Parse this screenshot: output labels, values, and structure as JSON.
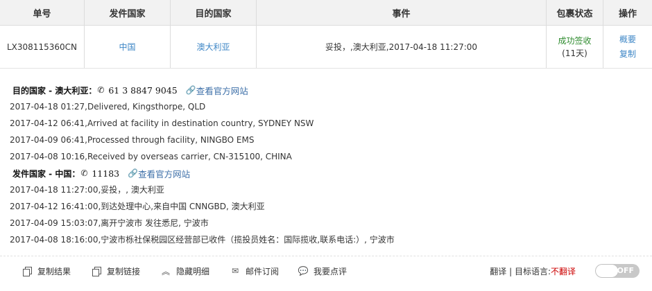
{
  "table": {
    "headers": [
      "单号",
      "发件国家",
      "目的国家",
      "事件",
      "包裹状态",
      "操作"
    ],
    "row": {
      "tracking_no": "LX308115360CN",
      "origin": "中国",
      "destination": "澳大利亚",
      "event": "妥投，,澳大利亚,2017-04-18 11:27:00",
      "status": "成功签收",
      "days": "(11天)",
      "op_summary": "概要",
      "op_copy": "复制"
    }
  },
  "destination_section": {
    "title": "目的国家 - 澳大利亚：",
    "phone": "61 3 8847 9045",
    "site_link": "查看官方网站",
    "events": [
      "2017-04-18 01:27,Delivered, Kingsthorpe, QLD",
      "2017-04-12 06:41,Arrived at facility in destination country, SYDNEY NSW",
      "2017-04-09 06:41,Processed through facility, NINGBO EMS",
      "2017-04-08 10:16,Received by overseas carrier, CN-315100, CHINA"
    ]
  },
  "origin_section": {
    "title": "发件国家 - 中国：",
    "phone": "11183",
    "site_link": "查看官方网站",
    "events": [
      "2017-04-18 11:27:00,妥投，, 澳大利亚",
      "2017-04-12 16:41:00,到达处理中心,来自中国 CNNGBD, 澳大利亚",
      "2017-04-09 15:03:07,离开宁波市 发往悉尼, 宁波市",
      "2017-04-08 18:16:00,宁波市栎社保税园区经营部已收件（揽投员姓名：国际揽收,联系电话:）, 宁波市"
    ]
  },
  "footer": {
    "copy_result": "复制结果",
    "copy_link": "复制链接",
    "hide_detail": "隐藏明细",
    "email_subscribe": "邮件订阅",
    "comment": "我要点评",
    "translate_label": "翻译 | 目标语言: ",
    "target_language": "不翻译",
    "toggle_state": "OFF"
  },
  "colors": {
    "link": "#3d86c6",
    "success": "#2e8b2e",
    "target_lang": "#cc0000"
  }
}
